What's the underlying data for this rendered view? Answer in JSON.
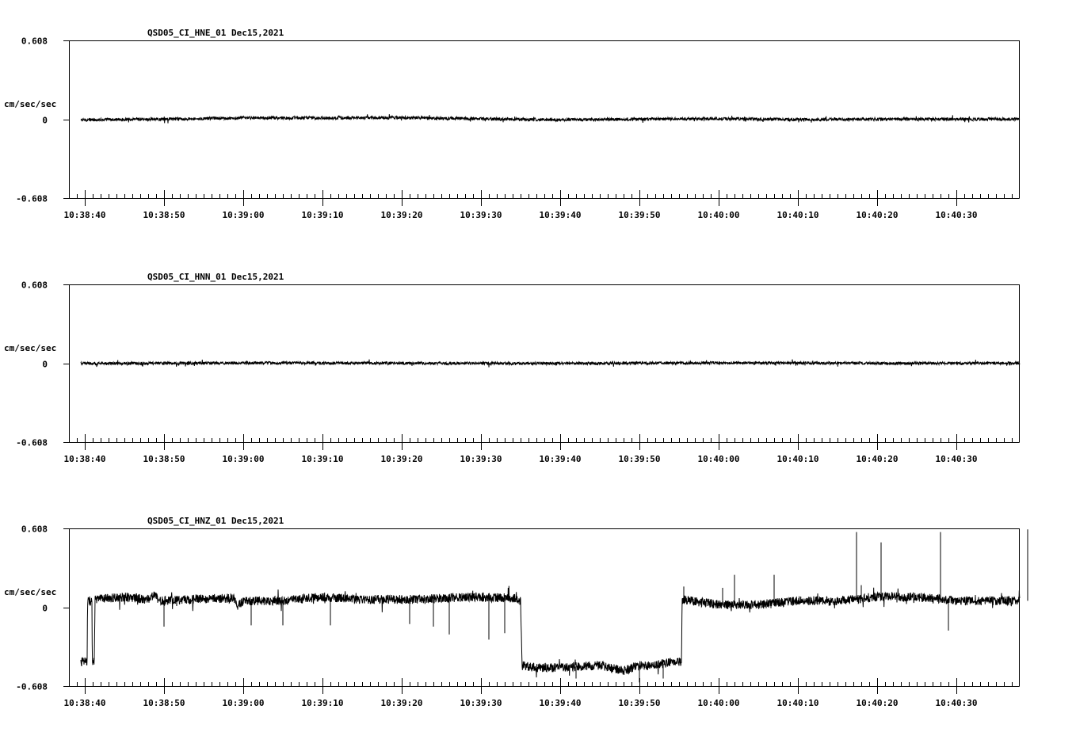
{
  "chart_data": [
    {
      "type": "line",
      "title": "QSD05_CI_HNE_01  Dec15,2021",
      "ylabel": "cm/sec/sec",
      "ylim": [
        -0.608,
        0.608
      ],
      "yticks": [
        "0.608",
        "0",
        "-0.608"
      ],
      "xticks": [
        "10:38:40",
        "10:38:50",
        "10:39:00",
        "10:39:10",
        "10:39:20",
        "10:39:30",
        "10:39:40",
        "10:39:50",
        "10:40:00",
        "10:40:10",
        "10:40:20",
        "10:40:30"
      ],
      "xrange_seconds_from_first_tick": [
        -2,
        118
      ],
      "trace_start_seconds": -0.5,
      "trace_color": "#000000",
      "series": [
        {
          "baseline": [
            [
              -0.5,
              -0.005
            ],
            [
              10,
              0.0
            ],
            [
              20,
              0.01
            ],
            [
              30,
              0.01
            ],
            [
              40,
              0.012
            ],
            [
              50,
              0.003
            ],
            [
              60,
              -0.005
            ],
            [
              70,
              0.0
            ],
            [
              80,
              0.005
            ],
            [
              90,
              -0.003
            ],
            [
              100,
              0.0
            ],
            [
              118,
              0.0
            ]
          ],
          "noise": 0.012,
          "spikes": []
        }
      ]
    },
    {
      "type": "line",
      "title": "QSD05_CI_HNN_01  Dec15,2021",
      "ylabel": "cm/sec/sec",
      "ylim": [
        -0.608,
        0.608
      ],
      "yticks": [
        "0.608",
        "0",
        "-0.608"
      ],
      "xticks": [
        "10:38:40",
        "10:38:50",
        "10:39:00",
        "10:39:10",
        "10:39:20",
        "10:39:30",
        "10:39:40",
        "10:39:50",
        "10:40:00",
        "10:40:10",
        "10:40:20",
        "10:40:30"
      ],
      "xrange_seconds_from_first_tick": [
        -2,
        118
      ],
      "trace_start_seconds": -0.5,
      "trace_color": "#000000",
      "series": [
        {
          "baseline": [
            [
              -0.5,
              -0.002
            ],
            [
              20,
              0.002
            ],
            [
              40,
              0.0
            ],
            [
              60,
              -0.002
            ],
            [
              80,
              0.003
            ],
            [
              100,
              0.0
            ],
            [
              118,
              0.0
            ]
          ],
          "noise": 0.011,
          "spikes": []
        }
      ]
    },
    {
      "type": "line",
      "title": "QSD05_CI_HNZ_01  Dec15,2021",
      "ylabel": "cm/sec/sec",
      "ylim": [
        -0.608,
        0.608
      ],
      "yticks": [
        "0.608",
        "0",
        "-0.608"
      ],
      "xticks": [
        "10:38:40",
        "10:38:50",
        "10:39:00",
        "10:39:10",
        "10:39:20",
        "10:39:30",
        "10:39:40",
        "10:39:50",
        "10:40:00",
        "10:40:10",
        "10:40:20",
        "10:40:30"
      ],
      "xrange_seconds_from_first_tick": [
        -2,
        118
      ],
      "trace_start_seconds": -0.5,
      "trace_color": "#000000",
      "series": [
        {
          "baseline": [
            [
              -0.5,
              -0.42
            ],
            [
              0.3,
              -0.42
            ],
            [
              0.35,
              0.05
            ],
            [
              0.9,
              0.05
            ],
            [
              0.95,
              -0.42
            ],
            [
              1.2,
              -0.42
            ],
            [
              1.3,
              0.06
            ],
            [
              5,
              0.08
            ],
            [
              8,
              0.06
            ],
            [
              9,
              0.1
            ],
            [
              9.2,
              0.05
            ],
            [
              18,
              0.07
            ],
            [
              19,
              0.06
            ],
            [
              19.2,
              0.0
            ],
            [
              20,
              0.05
            ],
            [
              25,
              0.05
            ],
            [
              30,
              0.08
            ],
            [
              35,
              0.06
            ],
            [
              42,
              0.06
            ],
            [
              48,
              0.08
            ],
            [
              54,
              0.07
            ],
            [
              55,
              0.05
            ],
            [
              55.2,
              -0.45
            ],
            [
              57,
              -0.47
            ],
            [
              65,
              -0.45
            ],
            [
              68,
              -0.49
            ],
            [
              70,
              -0.45
            ],
            [
              72,
              -0.45
            ],
            [
              74,
              -0.42
            ],
            [
              75.3,
              -0.42
            ],
            [
              75.4,
              0.06
            ],
            [
              80,
              0.02
            ],
            [
              85,
              0.02
            ],
            [
              90,
              0.05
            ],
            [
              95,
              0.05
            ],
            [
              100,
              0.08
            ],
            [
              105,
              0.08
            ],
            [
              110,
              0.05
            ],
            [
              118,
              0.05
            ]
          ],
          "noise": 0.035,
          "spikes": [
            [
              10,
              -0.15
            ],
            [
              21,
              -0.14
            ],
            [
              25,
              -0.14
            ],
            [
              31,
              -0.14
            ],
            [
              41,
              -0.13
            ],
            [
              44,
              -0.15
            ],
            [
              46,
              -0.21
            ],
            [
              51,
              -0.25
            ],
            [
              53,
              -0.2
            ],
            [
              62,
              -0.55
            ],
            [
              70,
              -0.58
            ],
            [
              73,
              -0.55
            ],
            [
              75.6,
              0.16
            ],
            [
              80.5,
              0.15
            ],
            [
              82,
              0.25
            ],
            [
              87,
              0.25
            ],
            [
              97.4,
              0.58
            ],
            [
              98,
              0.17
            ],
            [
              100.5,
              0.5
            ],
            [
              108,
              0.58
            ],
            [
              109,
              -0.18
            ],
            [
              119,
              0.6
            ]
          ]
        }
      ]
    }
  ]
}
